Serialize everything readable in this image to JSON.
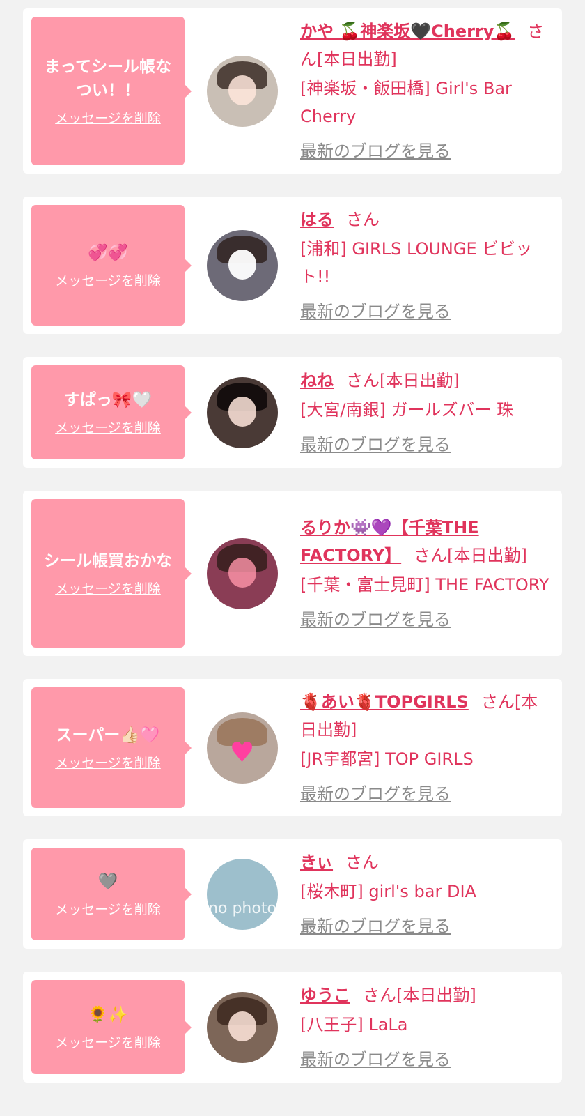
{
  "colors": {
    "page_bg": "#f2f2f2",
    "card_bg": "#ffffff",
    "bubble_bg": "#ff99aa",
    "accent_text": "#e0345c",
    "link_gray": "#8a8a8a"
  },
  "cards": [
    {
      "message": "まってシール帳なつい！！",
      "delete_label": "メッセージを削除",
      "avatar_icon": "photo-avatar",
      "avatar_bg": "#c9bfb5",
      "name": "かや 🍒神楽坂🖤Cherry🍒",
      "suffix": "さん[本日出勤]",
      "shop": "[神楽坂・飯田橋] Girl's Bar Cherry",
      "blog_label": "最新のブログを見る"
    },
    {
      "message": "💞💞",
      "delete_label": "メッセージを削除",
      "avatar_icon": "photo-avatar",
      "avatar_bg": "#6d6a77",
      "name": "はる",
      "suffix": "さん",
      "shop": "[浦和] GIRLS LOUNGE ビビット!!",
      "blog_label": "最新のブログを見る"
    },
    {
      "message": "すぱっ🎀🤍",
      "delete_label": "メッセージを削除",
      "avatar_icon": "photo-avatar",
      "avatar_bg": "#4a3a36",
      "name": "ねね",
      "suffix": "さん[本日出勤]",
      "shop": "[大宮/南銀] ガールズバー 珠",
      "blog_label": "最新のブログを見る"
    },
    {
      "message": "シール帳買おかな",
      "delete_label": "メッセージを削除",
      "avatar_icon": "photo-avatar",
      "avatar_bg": "#8a3d55",
      "name": "るりか👾💜【千葉THE FACTORY】",
      "suffix": "さん[本日出勤]",
      "shop": "[千葉・富士見町] THE FACTORY",
      "blog_label": "最新のブログを見る"
    },
    {
      "message": "スーパー👍🏻🩷",
      "delete_label": "メッセージを削除",
      "avatar_icon": "photo-avatar",
      "avatar_bg": "#b9a79c",
      "name": "🫀あい🫀TOPGIRLS",
      "suffix": "さん[本日出勤]",
      "shop": "[JR宇都宮] TOP GIRLS",
      "blog_label": "最新のブログを見る"
    },
    {
      "message": "🩶",
      "delete_label": "メッセージを削除",
      "avatar_icon": "no-photo-avatar",
      "avatar_bg": "#9dbfcc",
      "avatar_text": "no photo",
      "name": "きぃ",
      "suffix": "さん",
      "shop": "[桜木町] girl's bar DIA",
      "blog_label": "最新のブログを見る"
    },
    {
      "message": "🌻✨",
      "delete_label": "メッセージを削除",
      "avatar_icon": "photo-avatar",
      "avatar_bg": "#7d6658",
      "name": "ゆうこ",
      "suffix": "さん[本日出勤]",
      "shop": "[八王子] LaLa",
      "blog_label": "最新のブログを見る"
    }
  ]
}
